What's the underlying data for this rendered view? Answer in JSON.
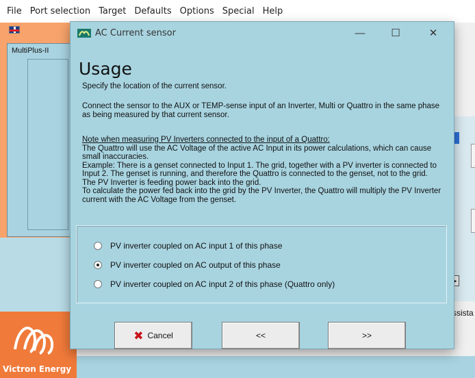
{
  "menubar": {
    "items": [
      "File",
      "Port selection",
      "Target",
      "Defaults",
      "Options",
      "Special",
      "Help"
    ]
  },
  "background": {
    "product_label": "MultiPlus-II",
    "assist_text": "ssista",
    "logo_text": "Victron Energy",
    "flag_icon": "uk-flag-icon",
    "accent_orange": "#f07a3a"
  },
  "dialog": {
    "title": "AC Current sensor",
    "title_icon": "victron-app-icon",
    "controls": {
      "minimize": "—",
      "maximize": "☐",
      "close": "✕"
    },
    "heading": "Usage",
    "intro": "Specify the location of the current sensor.",
    "connect_text": "Connect the sensor to the AUX or TEMP-sense input of an Inverter, Multi or Quattro in the same phase as being measured by that current sensor.",
    "note_heading": "Note when measuring PV Inverters connected to the input of a Quattro:",
    "note_lines": [
      "The Quattro will use the AC Voltage of the active AC Input in its power calculations, which can cause small inaccuracies.",
      "Example: There is a genset connected to Input 1. The grid, together with a PV inverter is connected to Input 2. The genset is running, and therefore the Quattro is connected to the genset, not to the grid. The PV Inverter is feeding power back into the grid.",
      "To calculate the power fed back into the grid by the PV Inverter, the Quattro will multiply the PV Inverter current with the AC Voltage from the genset."
    ],
    "options": [
      {
        "label": "PV inverter coupled on AC input 1 of this phase",
        "selected": false
      },
      {
        "label": "PV inverter coupled on AC output of this phase",
        "selected": true
      },
      {
        "label": "PV inverter coupled on AC input 2 of this phase (Quattro only)",
        "selected": false
      }
    ],
    "buttons": {
      "cancel": "Cancel",
      "back": "<<",
      "next": ">>"
    },
    "background_color": "#a8d4e0"
  }
}
